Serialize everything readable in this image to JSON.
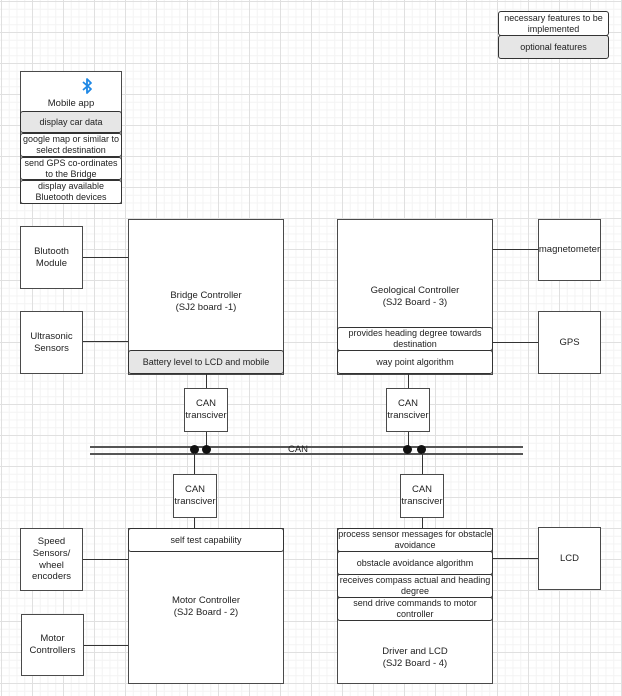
{
  "legend": {
    "necessary": "necessary features to be implemented",
    "optional": "optional features"
  },
  "mobile_app": {
    "icon": "bluetooth-icon",
    "title": "Mobile app",
    "features": [
      {
        "text": "display car data",
        "optional": true
      },
      {
        "text": "google map or similar to select destination",
        "optional": false
      },
      {
        "text": "send GPS co-ordinates to the Bridge",
        "optional": false
      },
      {
        "text": "display available Bluetooth devices",
        "optional": false
      }
    ]
  },
  "peripherals": {
    "bluetooth_module": "Blutooth Module",
    "ultrasonic_sensors": "Ultrasonic Sensors",
    "magnetometer": "magnetometer",
    "gps": "GPS",
    "speed_sensors": "Speed Sensors/ wheel encoders",
    "motor_controllers": "Motor Controllers",
    "lcd": "LCD"
  },
  "controllers": {
    "bridge": {
      "name": "Bridge Controller",
      "board": "(SJ2 board -1)",
      "features": [
        {
          "text": "Battery level to LCD and mobile",
          "optional": true
        }
      ]
    },
    "geological": {
      "name": "Geological Controller",
      "board": "(SJ2 Board - 3)",
      "features": [
        {
          "text": "provides heading degree towards destination",
          "optional": false
        },
        {
          "text": "way point algorithm",
          "optional": false
        }
      ]
    },
    "motor": {
      "name": "Motor Controller",
      "board": "(SJ2 Board - 2)",
      "features": [
        {
          "text": "self test capability",
          "optional": false
        }
      ]
    },
    "driver": {
      "name": "Driver and LCD",
      "board": "(SJ2 Board - 4)",
      "features": [
        {
          "text": "process sensor messages for obstacle avoidance",
          "optional": false
        },
        {
          "text": "obstacle avoidance algorithm",
          "optional": false
        },
        {
          "text": "receives compass actual and heading degree",
          "optional": false
        },
        {
          "text": "send drive commands to motor controller",
          "optional": false
        }
      ]
    }
  },
  "can": {
    "bus_label": "CAN",
    "transceiver_label": "CAN transciver"
  },
  "colors": {
    "bluetooth": "#1e88e5",
    "optional_fill": "#e6e6e6",
    "stroke": "#333333"
  }
}
